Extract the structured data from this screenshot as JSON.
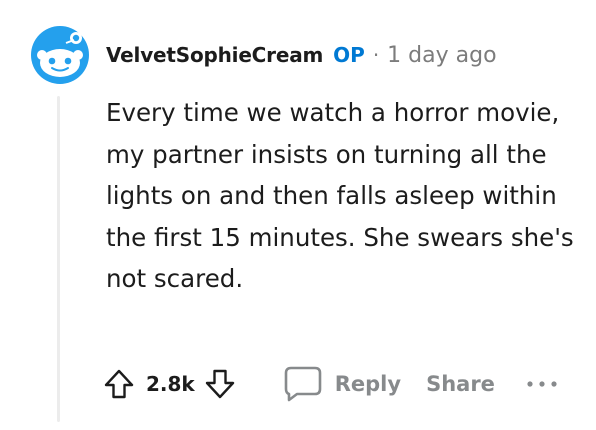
{
  "comment": {
    "author": "VelvetSophieCream",
    "op_badge": "OP",
    "separator": "·",
    "timestamp": "1 day ago",
    "body": "Every time we watch a horror movie, my partner insists on turning all the lights on and then falls asleep within the first 15 minutes. She swears she's not scared.",
    "avatar_icon": "snoo-avatar-icon",
    "avatar_color": "#24a0ed"
  },
  "actions": {
    "upvote_icon": "upvote-arrow-icon",
    "score": "2.8k",
    "downvote_icon": "downvote-arrow-icon",
    "reply_icon": "speech-bubble-icon",
    "reply_label": "Reply",
    "share_label": "Share",
    "more_icon": "ellipsis-icon",
    "icon_color": "#878a8c"
  }
}
